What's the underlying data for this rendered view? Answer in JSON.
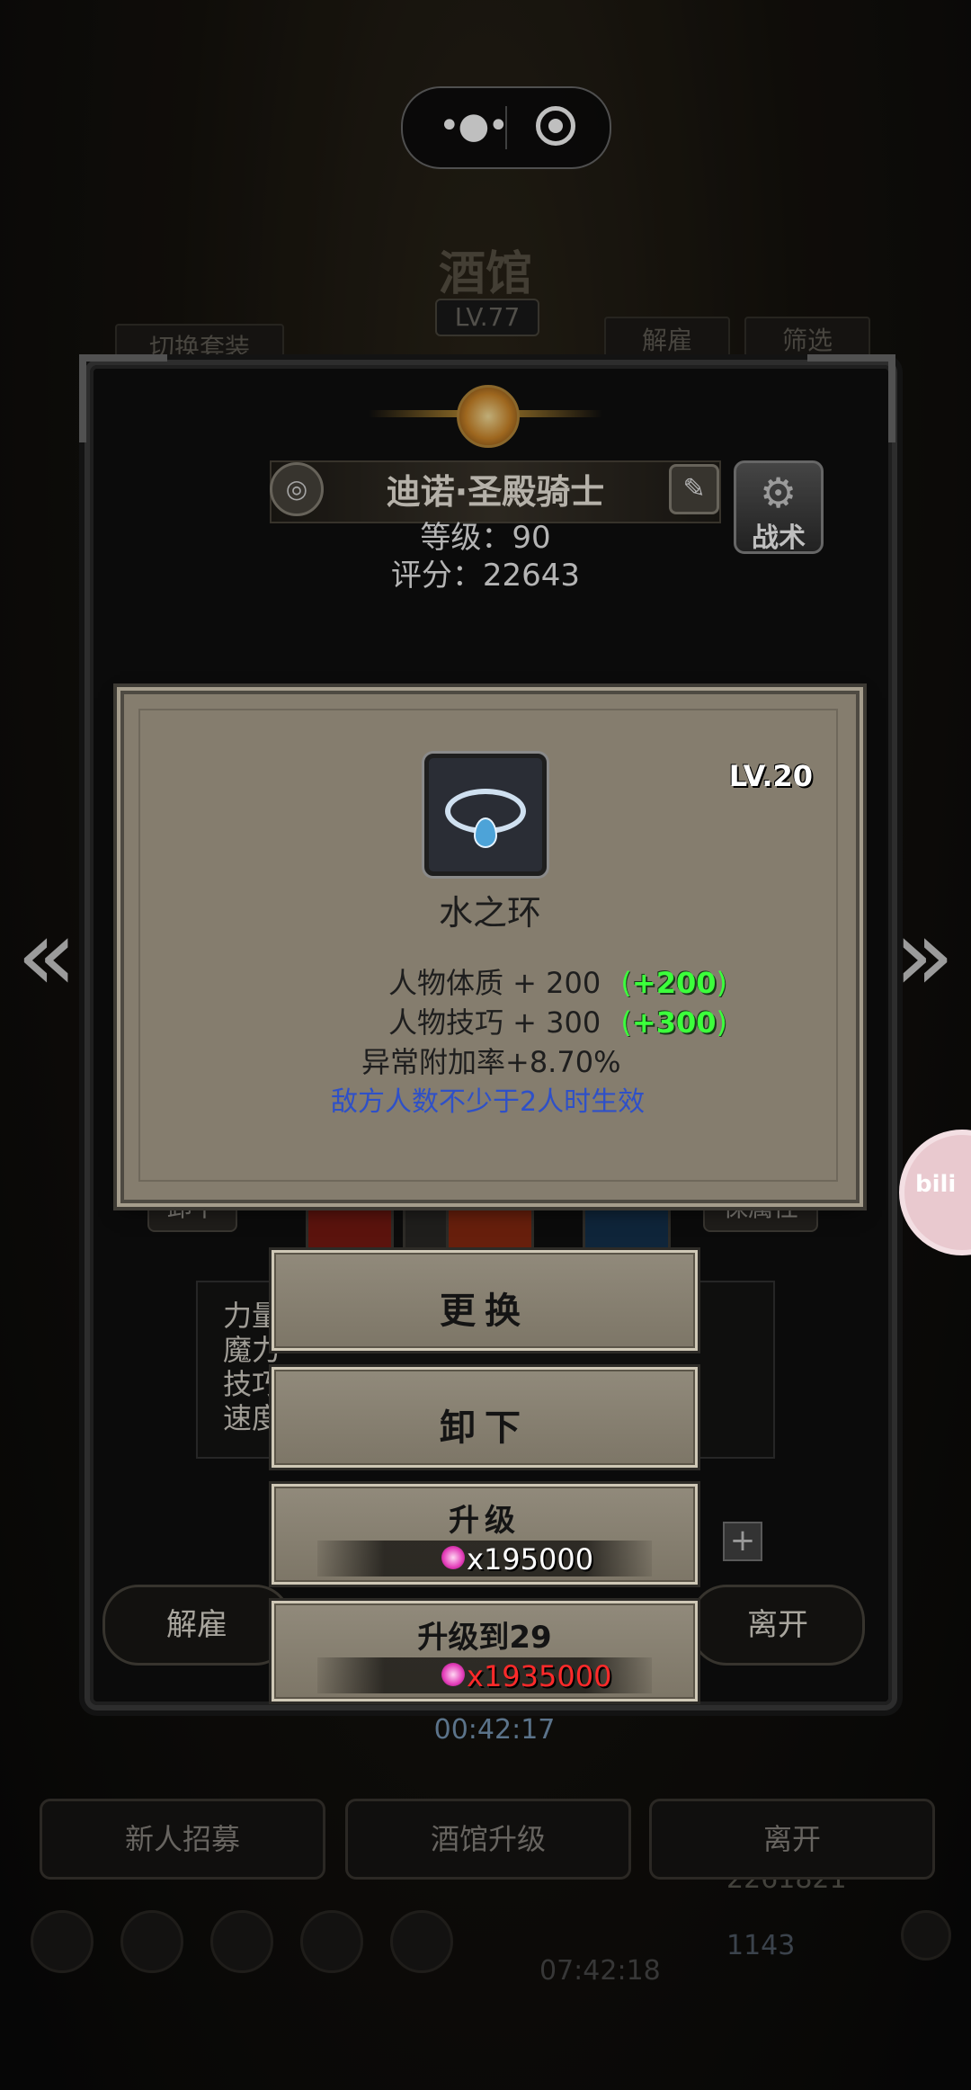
{
  "top_capsule": {
    "more_icon": "more-dots-icon",
    "close_icon": "target-circle-icon"
  },
  "background": {
    "title": "酒馆",
    "level": "LV.77",
    "switch_outfit": "切换套装",
    "dismiss": "解雇",
    "filter": "筛选",
    "timer": "00:42:17",
    "bottom_buttons": [
      "新人招募",
      "酒馆升级",
      "离开"
    ],
    "resource_amount": "2261821",
    "gem_amount": "1143",
    "clock": "07:42:18"
  },
  "hero": {
    "name": "迪诺·圣殿骑士",
    "level_label": "等级：90",
    "score_label": "评分：22643",
    "tactics_label": "战术",
    "unequip_side": "卸下",
    "keep_side": "保属性",
    "stats": [
      "力量",
      "魔力",
      "技巧",
      "速度"
    ],
    "dismiss_button": "解雇",
    "leave_button": "离开"
  },
  "item_popup": {
    "level": "LV.20",
    "name": "水之环",
    "icon": "water-ring-icon",
    "attributes": [
      {
        "text": "人物体质 + 200",
        "bonus": "+200"
      },
      {
        "text": "人物技巧 + 300",
        "bonus": "+300"
      }
    ],
    "extra": "异常附加率+8.70%",
    "condition": "敌方人数不少于2人时生效"
  },
  "actions": {
    "replace": "更换",
    "unequip": "卸下",
    "upgrade": "升级",
    "upgrade_cost": "x195000",
    "upgrade_to": "升级到29",
    "upgrade_to_cost": "x1935000"
  },
  "colors": {
    "bonus_green": "#3cff3c",
    "condition_blue": "#2e50c8",
    "insufficient_red": "#ff2a2a",
    "popup_bg": "#857d6e"
  }
}
